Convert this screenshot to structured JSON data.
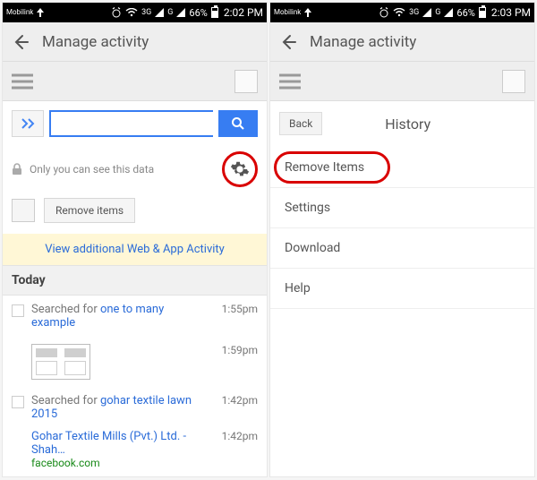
{
  "left": {
    "status": {
      "carrier": "Mobilink",
      "net_a": "3G",
      "net_b": "G",
      "battery_pct": "66%",
      "time": "2:02 PM",
      "batt_fill": 66
    },
    "appbar_title": "Manage activity",
    "search": {
      "value": "",
      "placeholder": ""
    },
    "privacy_text": "Only you can see this data",
    "remove_items_label": "Remove items",
    "banner_text": "View additional Web & App Activity",
    "section_today": "Today",
    "rows": {
      "r0_prefix": "Searched for ",
      "r0_query": "one to many example",
      "r0_time": "1:55pm",
      "r1_time": "1:59pm",
      "r2_prefix": "Searched for ",
      "r2_query": "gohar textile lawn 2015",
      "r2_time": "1:42pm",
      "r3_title": "Gohar Textile Mills (Pvt.) Ltd. - Shah…",
      "r3_site": "facebook.com",
      "r3_time": "1:42pm"
    }
  },
  "right": {
    "status": {
      "carrier": "Mobilink",
      "net_a": "3G",
      "net_b": "G",
      "battery_pct": "66%",
      "time": "2:03 PM",
      "batt_fill": 66
    },
    "appbar_title": "Manage activity",
    "back_label": "Back",
    "history_title": "History",
    "menu": {
      "remove_items": "Remove Items",
      "settings": "Settings",
      "download": "Download",
      "help": "Help"
    }
  },
  "colors": {
    "accent": "#377df2",
    "highlight_ring": "#d90000",
    "banner_bg": "#fff7d6"
  }
}
